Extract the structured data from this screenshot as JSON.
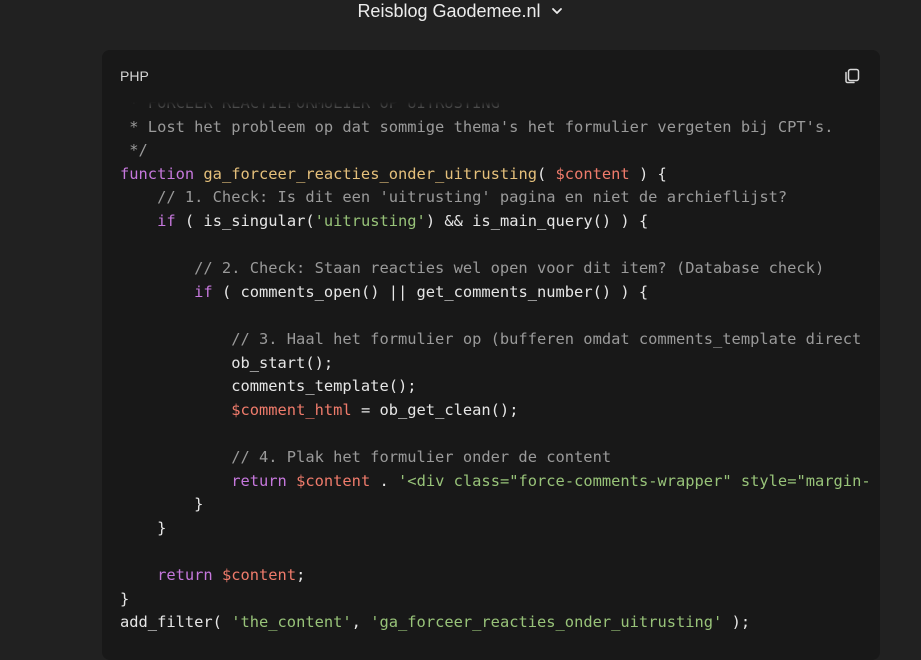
{
  "header": {
    "title": "Reisblog Gaodemee.nl",
    "chevron_icon": "chevron-down-icon"
  },
  "code_block": {
    "language": "PHP",
    "copy_icon": "copy-icon",
    "lines": [
      [
        [
          "c",
          " * FORCEER REACTIEFORMULIER OP UITRUSTING"
        ]
      ],
      [
        [
          "c",
          " * Lost het probleem op dat sommige thema's het formulier vergeten bij CPT's."
        ]
      ],
      [
        [
          "c",
          " */"
        ]
      ],
      [
        [
          "k",
          "function "
        ],
        [
          "f",
          "ga_forceer_reacties_onder_uitrusting"
        ],
        [
          "p",
          "( "
        ],
        [
          "v",
          "$content"
        ],
        [
          "p",
          " ) {"
        ]
      ],
      [
        [
          "c",
          "    // 1. Check: Is dit een 'uitrusting' pagina en niet de archieflijst?"
        ]
      ],
      [
        [
          "p",
          "    "
        ],
        [
          "k",
          "if"
        ],
        [
          "p",
          " ( is_singular("
        ],
        [
          "s",
          "'uitrusting'"
        ],
        [
          "p",
          ") && is_main_query() ) {"
        ]
      ],
      [
        [
          "p",
          ""
        ]
      ],
      [
        [
          "c",
          "        // 2. Check: Staan reacties wel open voor dit item? (Database check)"
        ]
      ],
      [
        [
          "p",
          "        "
        ],
        [
          "k",
          "if"
        ],
        [
          "p",
          " ( comments_open() || get_comments_number() ) {"
        ]
      ],
      [
        [
          "p",
          ""
        ]
      ],
      [
        [
          "c",
          "            // 3. Haal het formulier op (bufferen omdat comments_template direct"
        ]
      ],
      [
        [
          "p",
          "            ob_start();"
        ]
      ],
      [
        [
          "p",
          "            comments_template();"
        ]
      ],
      [
        [
          "p",
          "            "
        ],
        [
          "v",
          "$comment_html"
        ],
        [
          "p",
          " = ob_get_clean();"
        ]
      ],
      [
        [
          "p",
          ""
        ]
      ],
      [
        [
          "c",
          "            // 4. Plak het formulier onder de content"
        ]
      ],
      [
        [
          "p",
          "            "
        ],
        [
          "k",
          "return "
        ],
        [
          "v",
          "$content"
        ],
        [
          "p",
          " . "
        ],
        [
          "s",
          "'<div class=\"force-comments-wrapper\" style=\"margin-"
        ]
      ],
      [
        [
          "p",
          "        }"
        ]
      ],
      [
        [
          "p",
          "    }"
        ]
      ],
      [
        [
          "p",
          ""
        ]
      ],
      [
        [
          "p",
          "    "
        ],
        [
          "k",
          "return "
        ],
        [
          "v",
          "$content"
        ],
        [
          "p",
          ";"
        ]
      ],
      [
        [
          "p",
          "}"
        ]
      ],
      [
        [
          "p",
          "add_filter( "
        ],
        [
          "s",
          "'the_content'"
        ],
        [
          "p",
          ", "
        ],
        [
          "s",
          "'ga_forceer_reacties_onder_uitrusting'"
        ],
        [
          "p",
          " );"
        ]
      ]
    ]
  }
}
